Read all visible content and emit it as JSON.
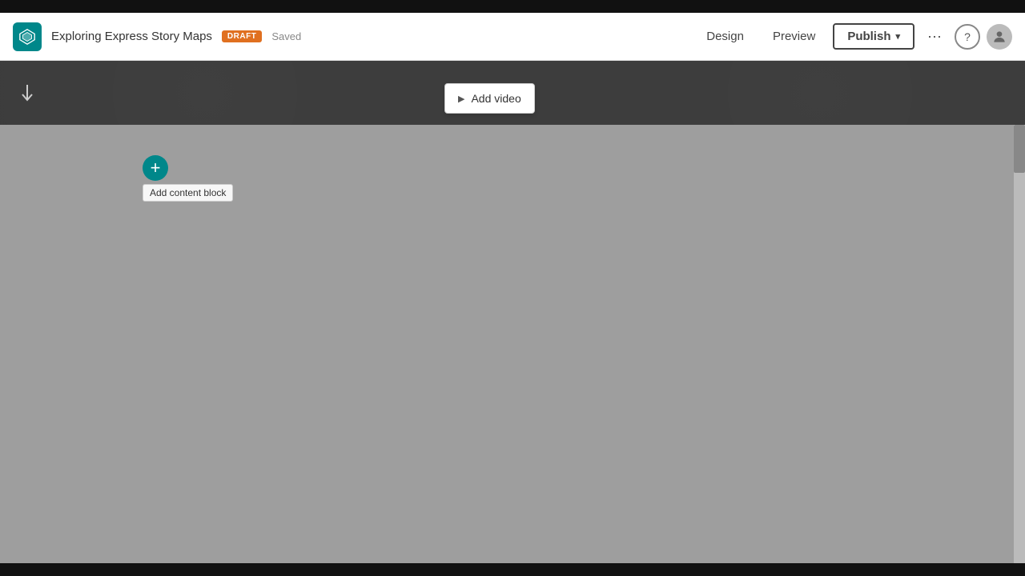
{
  "topBar": {
    "height": 16
  },
  "header": {
    "logo": {
      "alt": "Story Maps logo"
    },
    "title": "Exploring Express Story Maps",
    "draftBadge": "DRAFT",
    "savedLabel": "Saved",
    "nav": {
      "design": "Design",
      "preview": "Preview"
    },
    "publishButton": "Publish",
    "moreButton": "···",
    "helpButton": "?",
    "avatar": "user-icon"
  },
  "darkSection": {
    "downArrow": "down-arrow"
  },
  "addVideoDropdown": {
    "label": "Add video"
  },
  "mainContent": {
    "addContentBlock": {
      "icon": "+",
      "tooltip": "Add content block"
    }
  }
}
